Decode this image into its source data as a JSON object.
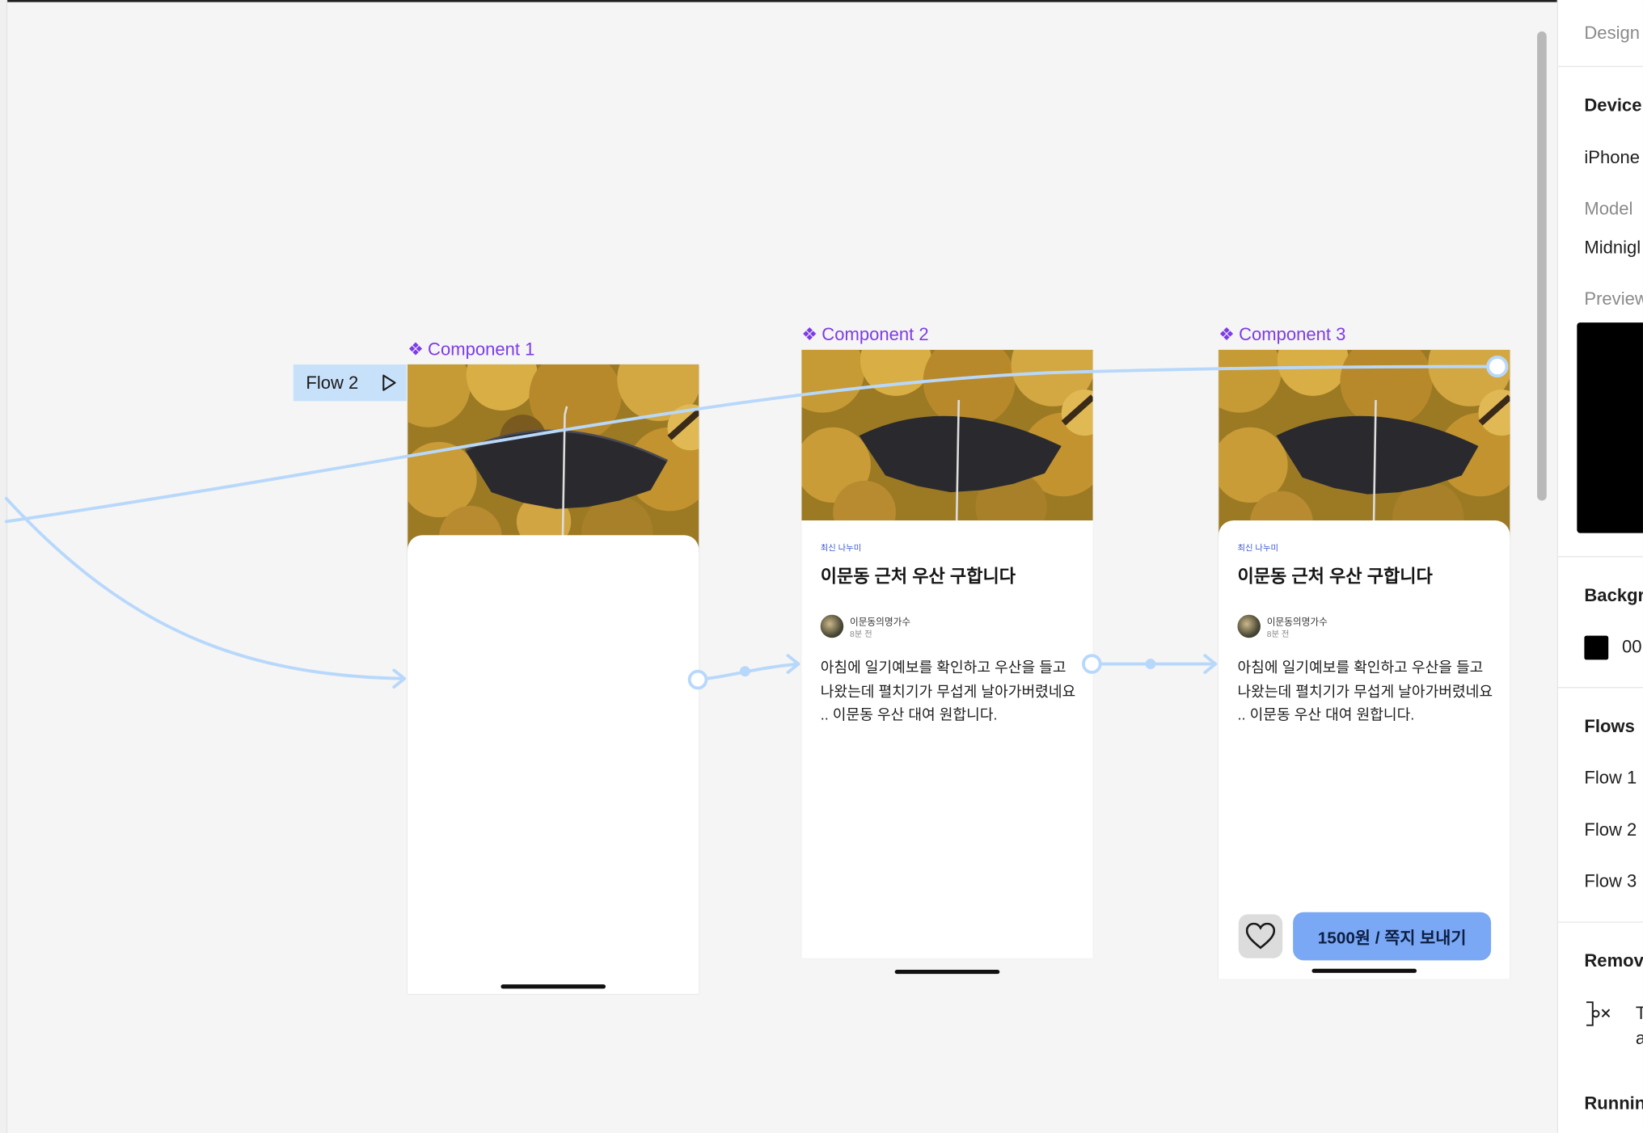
{
  "canvas": {
    "flow_tag": {
      "label": "Flow 2"
    },
    "components": [
      {
        "label": "Component 1"
      },
      {
        "label": "Component 2"
      },
      {
        "label": "Component 3"
      }
    ],
    "post": {
      "tag": "최신 나누미",
      "title": "이문동 근처 우산 구합니다",
      "user_name": "이문동의명가수",
      "time": "8분 전",
      "body": "아침에 일기예보를 확인하고 우산을 들고 나왔는데 펼치기가 무섭게 날아가버렸네요 .. 이문동 우산 대여 원합니다.",
      "send_button": "1500원 / 쪽지 보내기"
    }
  },
  "right_panel": {
    "tab": "Design",
    "device_heading": "Device",
    "device_value": "iPhone",
    "model_label": "Model",
    "model_value": "Midnigl",
    "preview_label": "Preview",
    "background_heading": "Backgr",
    "background_value": "00",
    "flows_heading": "Flows",
    "flows": [
      "Flow 1",
      "Flow 2",
      "Flow 3"
    ],
    "remove_heading": "Remov",
    "remove_text_1": "T",
    "remove_text_2": "a",
    "running_heading": "Runnin"
  },
  "colors": {
    "canvas_bg": "#f5f5f5",
    "component_label": "#7d3ce6",
    "connector": "#b8d8fb",
    "flow_tag_bg": "#c8e1fb",
    "send_button": "#7aa8f5",
    "tag_text": "#3d5bdb"
  }
}
